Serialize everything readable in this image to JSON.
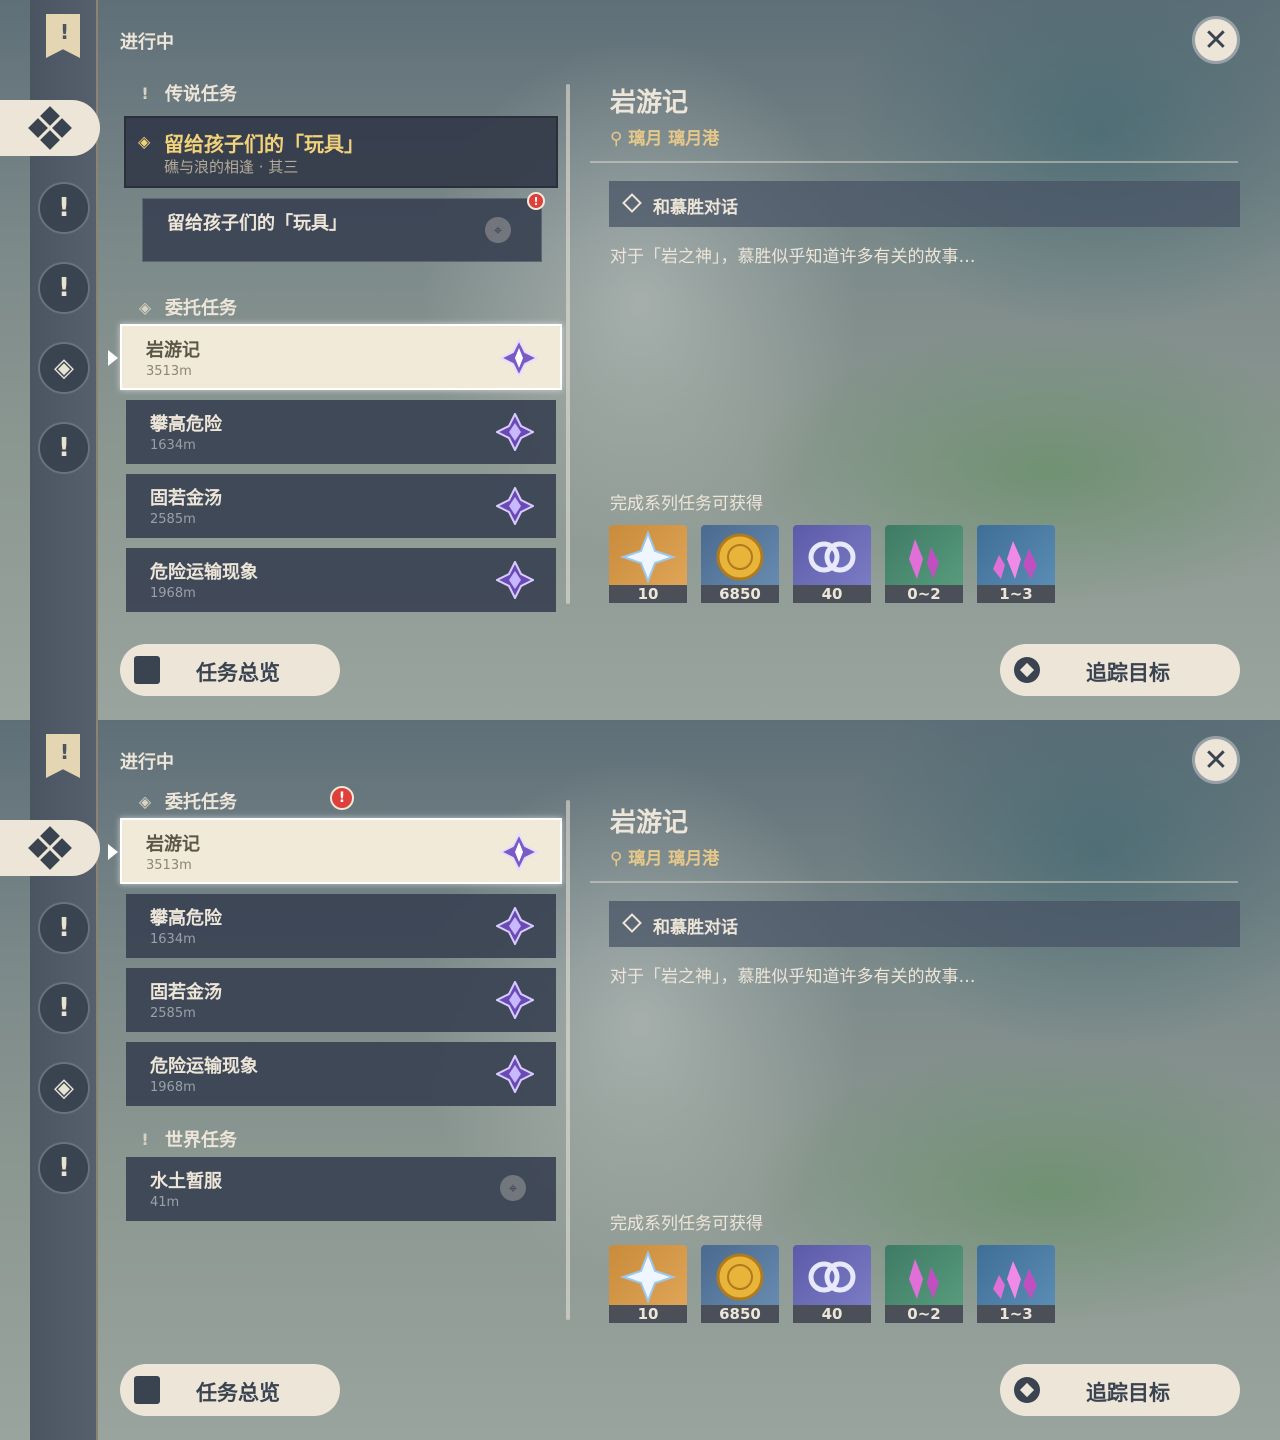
{
  "header": {
    "in_progress": "进行中"
  },
  "categories": {
    "legend": "传说任务",
    "commission": "委托任务",
    "world": "世界任务"
  },
  "legend_quest": {
    "title": "留给孩子们的「玩具」",
    "subtitle": "礁与浪的相逢 · 其三",
    "sub_item": "留给孩子们的「玩具」"
  },
  "quests": [
    {
      "name": "岩游记",
      "dist": "3513m"
    },
    {
      "name": "攀高危险",
      "dist": "1634m"
    },
    {
      "name": "固若金汤",
      "dist": "2585m"
    },
    {
      "name": "危险运输现象",
      "dist": "1968m"
    }
  ],
  "world_quest": {
    "name": "水土暂服",
    "dist": "41m"
  },
  "detail": {
    "title": "岩游记",
    "location": "璃月  璃月港",
    "objective": "和慕胜对话",
    "description": "对于「岩之神」，慕胜似乎知道许多有关的故事…",
    "rewards_heading": "完成系列任务可获得",
    "rewards": [
      {
        "icon": "primogem-icon",
        "count": "10"
      },
      {
        "icon": "mora-icon",
        "count": "6850"
      },
      {
        "icon": "adventure-exp-icon",
        "count": "40"
      },
      {
        "icon": "crystal-icon",
        "count": "0~2"
      },
      {
        "icon": "crystal-cluster-icon",
        "count": "1~3"
      }
    ]
  },
  "buttons": {
    "overview": "任务总览",
    "track": "追踪目标",
    "close": "✕"
  },
  "icons": {
    "alert": "!",
    "pin": "⌖",
    "location": "⚲"
  },
  "colors": {
    "accent_gold": "#f1d27a",
    "panel": "#3a4252",
    "cream": "#ece5d8",
    "alert_red": "#e0403c"
  }
}
